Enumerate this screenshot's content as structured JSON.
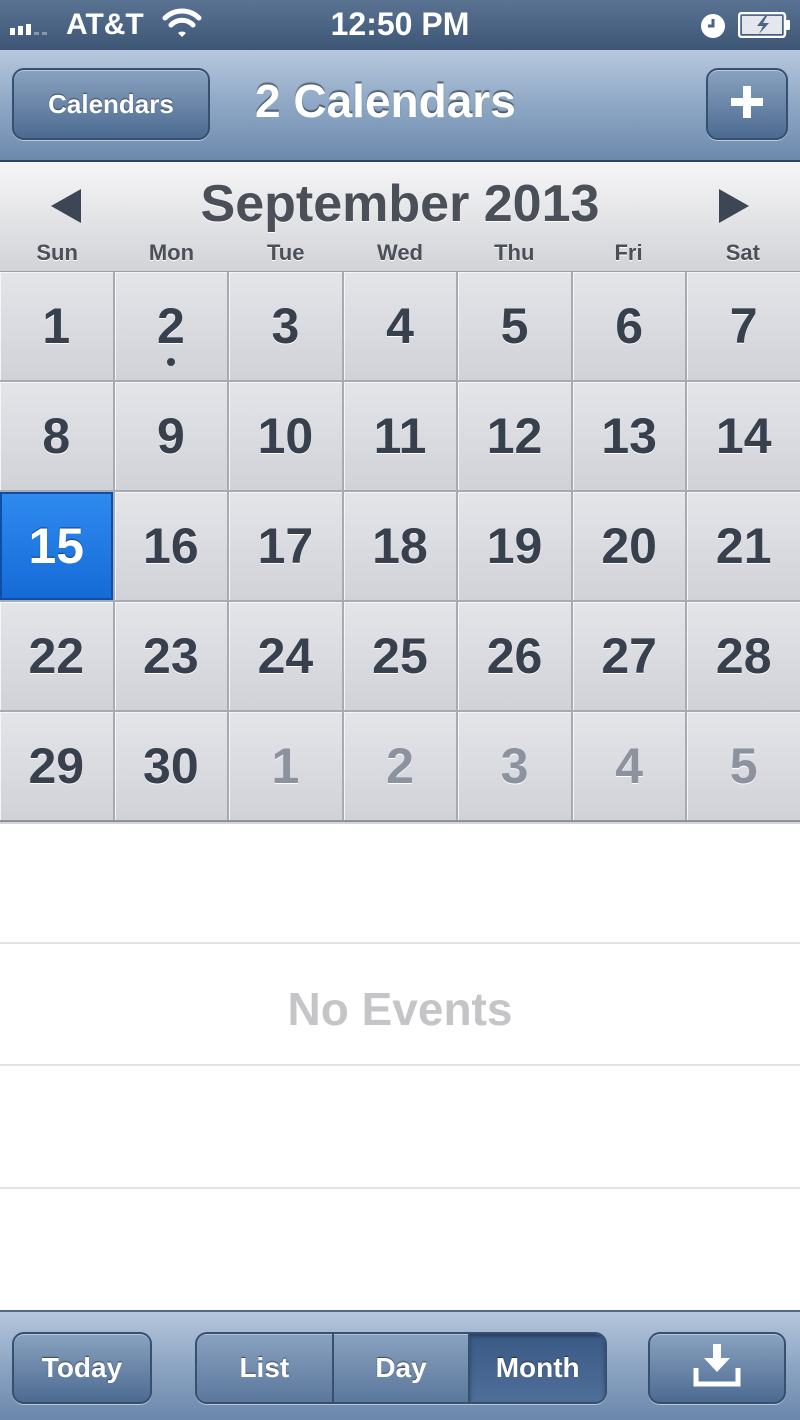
{
  "status_bar": {
    "carrier": "AT&T",
    "time": "12:50 PM",
    "icons": [
      "signal-icon",
      "wifi-icon",
      "alarm-clock-icon",
      "battery-charging-icon"
    ]
  },
  "nav": {
    "left_button": "Calendars",
    "title": "2 Calendars",
    "right_button_icon": "plus-icon"
  },
  "month": {
    "title": "September 2013",
    "weekdays": [
      "Sun",
      "Mon",
      "Tue",
      "Wed",
      "Thu",
      "Fri",
      "Sat"
    ]
  },
  "days": [
    {
      "label": "1",
      "current_month": true
    },
    {
      "label": "2",
      "current_month": true,
      "has_event": true
    },
    {
      "label": "3",
      "current_month": true
    },
    {
      "label": "4",
      "current_month": true
    },
    {
      "label": "5",
      "current_month": true
    },
    {
      "label": "6",
      "current_month": true
    },
    {
      "label": "7",
      "current_month": true
    },
    {
      "label": "8",
      "current_month": true
    },
    {
      "label": "9",
      "current_month": true
    },
    {
      "label": "10",
      "current_month": true
    },
    {
      "label": "11",
      "current_month": true
    },
    {
      "label": "12",
      "current_month": true
    },
    {
      "label": "13",
      "current_month": true
    },
    {
      "label": "14",
      "current_month": true
    },
    {
      "label": "15",
      "current_month": true,
      "selected": true
    },
    {
      "label": "16",
      "current_month": true
    },
    {
      "label": "17",
      "current_month": true
    },
    {
      "label": "18",
      "current_month": true
    },
    {
      "label": "19",
      "current_month": true
    },
    {
      "label": "20",
      "current_month": true
    },
    {
      "label": "21",
      "current_month": true
    },
    {
      "label": "22",
      "current_month": true
    },
    {
      "label": "23",
      "current_month": true
    },
    {
      "label": "24",
      "current_month": true
    },
    {
      "label": "25",
      "current_month": true
    },
    {
      "label": "26",
      "current_month": true
    },
    {
      "label": "27",
      "current_month": true
    },
    {
      "label": "28",
      "current_month": true
    },
    {
      "label": "29",
      "current_month": true
    },
    {
      "label": "30",
      "current_month": true
    },
    {
      "label": "1",
      "current_month": false
    },
    {
      "label": "2",
      "current_month": false
    },
    {
      "label": "3",
      "current_month": false
    },
    {
      "label": "4",
      "current_month": false
    },
    {
      "label": "5",
      "current_month": false
    }
  ],
  "events": {
    "empty_text": "No Events"
  },
  "toolbar": {
    "today_label": "Today",
    "segments": [
      "List",
      "Day",
      "Month"
    ],
    "active_segment": "Month",
    "inbox_icon": "inbox-icon"
  },
  "colors": {
    "selected_day": "#1a74e0",
    "nav_blue": "#6c89ad"
  }
}
